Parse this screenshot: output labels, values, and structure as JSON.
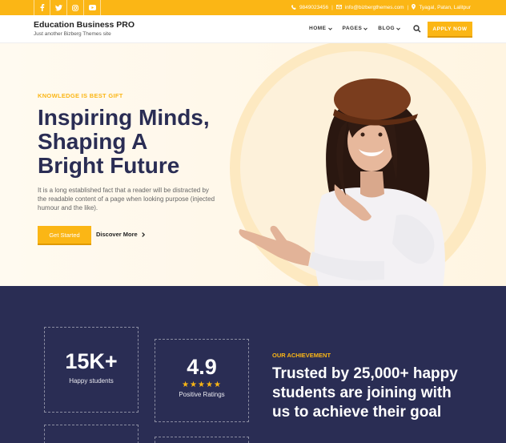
{
  "topbar": {
    "social": [
      "facebook-icon",
      "twitter-icon",
      "instagram-icon",
      "youtube-icon"
    ],
    "phone": "9849023456",
    "email": "info@bizbergthemes.com",
    "location": "Tyagal, Patan, Lalitpur"
  },
  "header": {
    "title": "Education Business PRO",
    "subtitle": "Just another Bizberg Themes site",
    "nav": [
      "HOME",
      "PAGES",
      "BLOG"
    ],
    "cta": "APPLY NOW"
  },
  "hero": {
    "kicker": "KNOWLEDGE IS BEST GIFT",
    "heading_lines": [
      "Inspiring Minds,",
      "Shaping A",
      "Bright Future"
    ],
    "description": "It is a long established fact that a reader will be distracted by the readable content of a page when looking purpose (injected humour and the like).",
    "primary_button": "Get Started",
    "secondary_link": "Discover More"
  },
  "stats": {
    "students_value": "15K+",
    "students_label": "Happy students",
    "rating_value": "4.9",
    "rating_stars": 5,
    "rating_label": "Positive Ratings"
  },
  "achievement": {
    "kicker": "OUR ACHIEVEMENT",
    "heading": "Trusted by 25,000+ happy students are joining with us to achieve their goal"
  },
  "colors": {
    "accent": "#fbb615",
    "navy": "#2a2d54"
  }
}
